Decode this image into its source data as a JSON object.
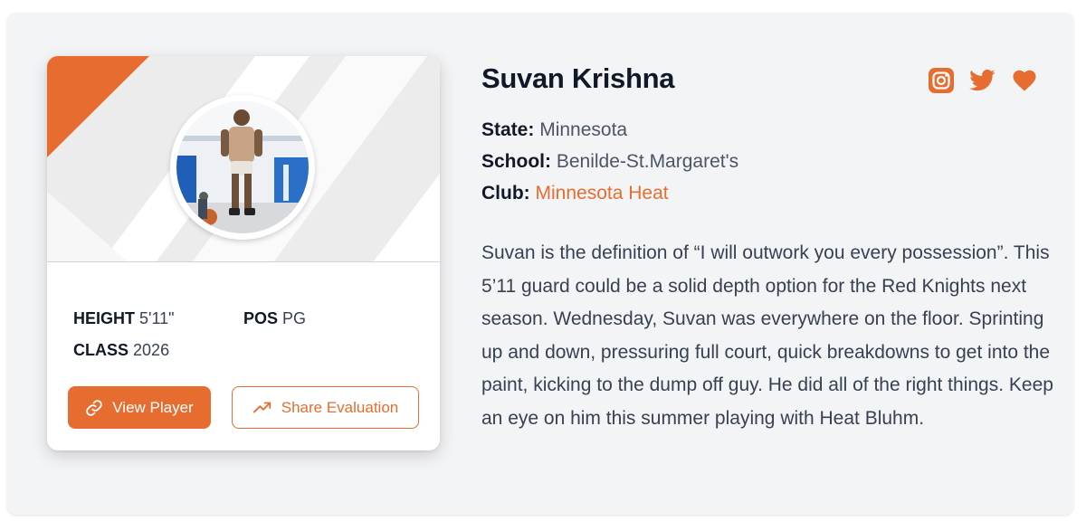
{
  "player": {
    "name": "Suvan Krishna",
    "state_label": "State:",
    "state": "Minnesota",
    "school_label": "School:",
    "school": "Benilde-St.Margaret's",
    "club_label": "Club:",
    "club": "Minnesota Heat",
    "bio": "Suvan is the definition of “I will outwork you every possession”. This 5’11 guard could be a solid depth option for the Red Knights next season. Wednesday, Suvan was everywhere on the floor. Sprinting up and down, pressuring full court, quick breakdowns to get into the paint, kicking to the dump off guy. He did all of the right things. Keep an eye on him this summer playing with Heat Bluhm."
  },
  "stats": {
    "height_label": "HEIGHT",
    "height": "5'11\"",
    "pos_label": "POS",
    "pos": "PG",
    "class_label": "CLASS",
    "class": "2026"
  },
  "actions": {
    "view_player": "View Player",
    "share_evaluation": "Share Evaluation"
  },
  "social_icons": [
    "instagram-icon",
    "twitter-icon",
    "heart-icon"
  ],
  "colors": {
    "accent": "#e66d2f",
    "background": "#f3f4f6",
    "card": "#ffffff",
    "text_dark": "#111827",
    "text_body": "#374151"
  }
}
